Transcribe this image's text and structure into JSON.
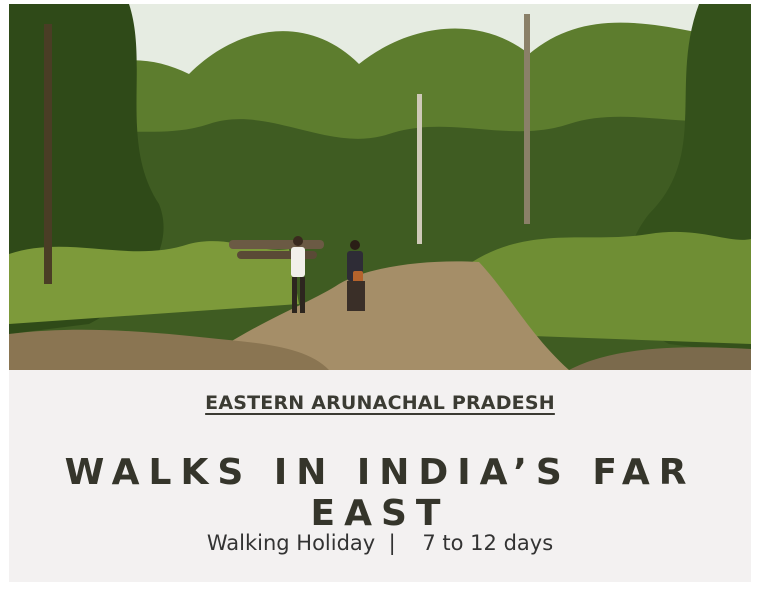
{
  "card": {
    "image": {
      "icon": "forest-path-photo"
    },
    "region": "EASTERN ARUNACHAL PRADESH",
    "title": "WALKS IN INDIA’S FAR EAST",
    "trip_type": "Walking Holiday",
    "separator": "|",
    "duration": "7 to 12 days"
  }
}
